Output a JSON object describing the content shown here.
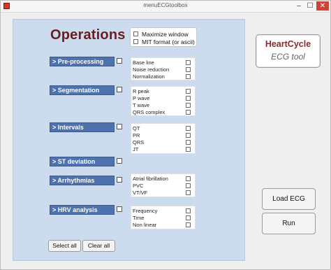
{
  "window": {
    "title": "menuECGtoolbox",
    "min_glyph": "–",
    "max_glyph": "☐",
    "close_glyph": "✕"
  },
  "main": {
    "heading": "Operations"
  },
  "options": [
    {
      "label": "Maximize window"
    },
    {
      "label": "MIT format (or ascii)"
    }
  ],
  "sections": [
    {
      "label": "> Pre-processing",
      "items": [
        "Base line",
        "Noise reduction",
        "Normalization"
      ]
    },
    {
      "label": "> Segmentation",
      "items": [
        "R peak",
        "P wave",
        "T wave",
        "QRS complex"
      ]
    },
    {
      "label": "> Intervals",
      "items": [
        "QT",
        "PR",
        "QRS",
        "JT"
      ]
    },
    {
      "label": "> ST deviation",
      "items": []
    },
    {
      "label": "> Arrhythmias",
      "items": [
        "Atrial fibrillation",
        "PVC",
        "VT/VF"
      ]
    },
    {
      "label": "> HRV analysis",
      "items": [
        "Frequency",
        "Time",
        "Non linear"
      ]
    }
  ],
  "footer": {
    "select_all": "Select all",
    "clear_all": "Clear all"
  },
  "brand": {
    "line1": "HeartCycle",
    "line2": "ECG tool"
  },
  "actions": {
    "load_ecg": "Load ECG",
    "run": "Run"
  },
  "colors": {
    "panel": "#ccdbee",
    "section_button": "#4d72ad",
    "heading": "#6a1e1e"
  },
  "icons": {
    "app": "matlab-figure-icon"
  }
}
